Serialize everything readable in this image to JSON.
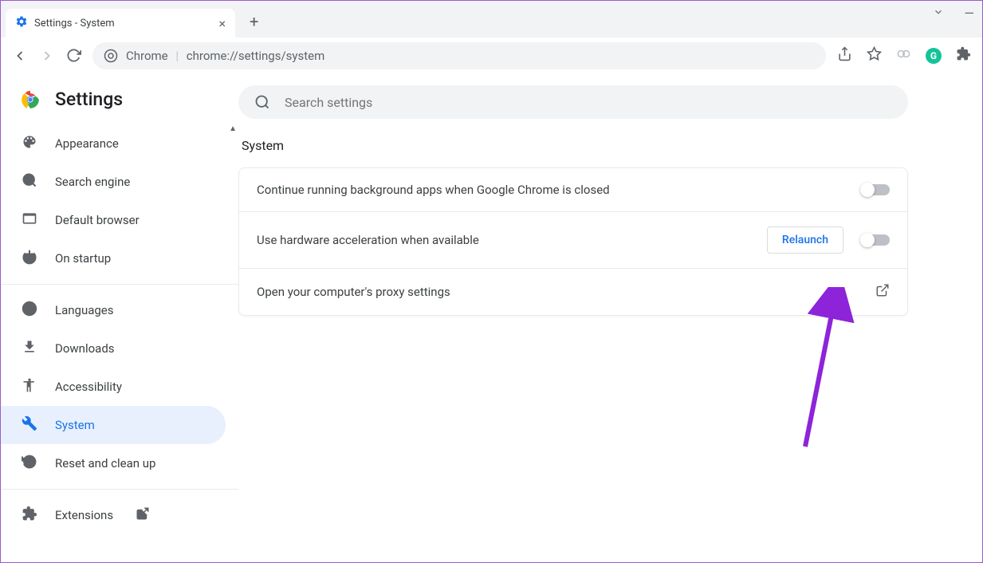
{
  "browser": {
    "tab_title": "Settings - System",
    "url_label": "Chrome",
    "url_path": "chrome://settings/system"
  },
  "header": {
    "title": "Settings",
    "search_placeholder": "Search settings"
  },
  "sidebar": {
    "items": [
      {
        "id": "appearance",
        "label": "Appearance",
        "icon": "palette"
      },
      {
        "id": "search-engine",
        "label": "Search engine",
        "icon": "search"
      },
      {
        "id": "default-browser",
        "label": "Default browser",
        "icon": "browser"
      },
      {
        "id": "on-startup",
        "label": "On startup",
        "icon": "power"
      },
      {
        "id": "languages",
        "label": "Languages",
        "icon": "globe"
      },
      {
        "id": "downloads",
        "label": "Downloads",
        "icon": "download"
      },
      {
        "id": "accessibility",
        "label": "Accessibility",
        "icon": "accessibility"
      },
      {
        "id": "system",
        "label": "System",
        "icon": "wrench",
        "active": true
      },
      {
        "id": "reset",
        "label": "Reset and clean up",
        "icon": "restore"
      },
      {
        "id": "extensions",
        "label": "Extensions",
        "icon": "puzzle",
        "external": true
      }
    ]
  },
  "main": {
    "section_title": "System",
    "rows": [
      {
        "label": "Continue running background apps when Google Chrome is closed",
        "toggle": false
      },
      {
        "label": "Use hardware acceleration when available",
        "toggle": false,
        "relaunch": "Relaunch"
      },
      {
        "label": "Open your computer's proxy settings",
        "external": true
      }
    ]
  }
}
